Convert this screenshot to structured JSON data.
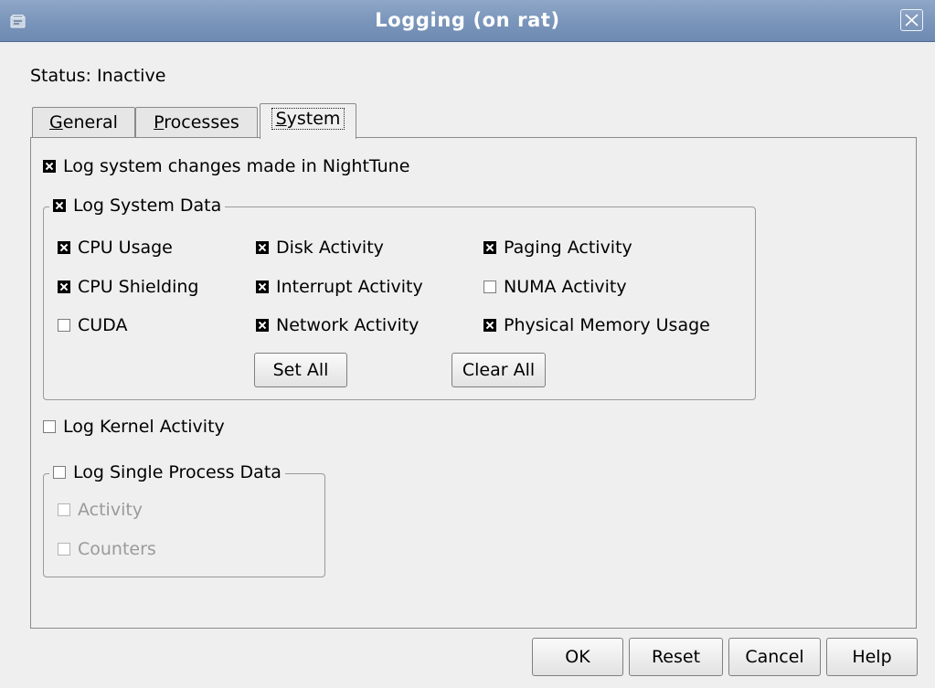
{
  "window": {
    "title": "Logging (on rat)",
    "app_icon": "app-window-icon",
    "close_icon": "close-icon"
  },
  "status": "Status: Inactive",
  "tabs": [
    {
      "underline": "G",
      "rest": "eneral",
      "active": false
    },
    {
      "underline": "P",
      "rest": "rocesses",
      "active": false
    },
    {
      "underline": "S",
      "rest": "ystem",
      "active": true
    }
  ],
  "system": {
    "log_changes": {
      "label": "Log system changes made in NightTune",
      "checked": true
    },
    "system_data": {
      "label": "Log System Data",
      "checked": true,
      "items": [
        {
          "label": "CPU Usage",
          "checked": true
        },
        {
          "label": "Disk Activity",
          "checked": true
        },
        {
          "label": "Paging Activity",
          "checked": true
        },
        {
          "label": "CPU Shielding",
          "checked": true
        },
        {
          "label": "Interrupt Activity",
          "checked": true
        },
        {
          "label": "NUMA Activity",
          "checked": false
        },
        {
          "label": "CUDA",
          "checked": false
        },
        {
          "label": "Network Activity",
          "checked": true
        },
        {
          "label": "Physical Memory Usage",
          "checked": true
        }
      ],
      "set_all": "Set All",
      "clear_all": "Clear All"
    },
    "kernel": {
      "label": "Log Kernel Activity",
      "checked": false
    },
    "single_process": {
      "label": "Log Single Process Data",
      "checked": false,
      "items": [
        {
          "label": "Activity",
          "checked": false,
          "disabled": true
        },
        {
          "label": "Counters",
          "checked": false,
          "disabled": true
        }
      ]
    }
  },
  "buttons": {
    "ok": "OK",
    "reset": "Reset",
    "cancel": "Cancel",
    "help": "Help"
  }
}
